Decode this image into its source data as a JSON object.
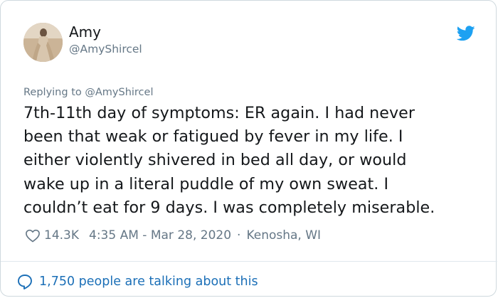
{
  "tweet": {
    "author_name": "Amy",
    "author_handle": "@AmyShircel",
    "replying_prefix": "Replying to ",
    "replying_handle": "@AmyShircel",
    "text": "7th-11th day of symptoms: ER again. I had never\nbeen that weak or fatigued by fever in my life. I\neither violently shivered in bed all day, or would\nwake up in a literal puddle of my own sweat. I\ncouldn’t eat for 9 days. I was completely miserable.",
    "likes": "14.3K",
    "time": "4:35 AM",
    "date_separator": " - ",
    "date": "Mar 28, 2020",
    "location_separator": "·",
    "location": "Kenosha, WI",
    "talking_text": "1,750 people are talking about this"
  },
  "icons": {
    "brand": "twitter-bird-icon",
    "like": "heart-icon",
    "talk": "speech-bubble-icon"
  },
  "colors": {
    "twitter_blue": "#1da1f2",
    "link_blue": "#1b6fb7",
    "text": "#14171a",
    "muted": "#657786",
    "border": "#cfd9de"
  }
}
